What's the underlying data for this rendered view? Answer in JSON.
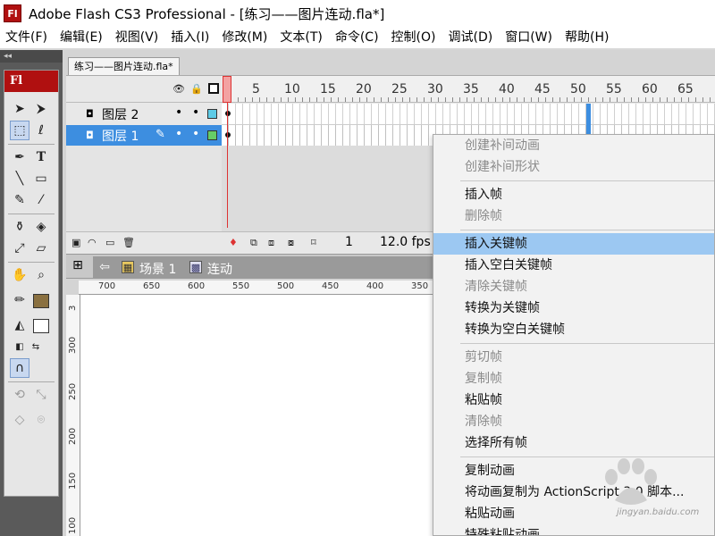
{
  "app": {
    "title": "Adobe Flash CS3 Professional - [练习——图片连动.fla*]",
    "logo_text": "Fl"
  },
  "menubar": {
    "items": [
      "文件(F)",
      "编辑(E)",
      "视图(V)",
      "插入(I)",
      "修改(M)",
      "文本(T)",
      "命令(C)",
      "控制(O)",
      "调试(D)",
      "窗口(W)",
      "帮助(H)"
    ]
  },
  "toolbar": {
    "logo": "Fl",
    "panel_collapse": "◂◂"
  },
  "document": {
    "tab_label": "练习——图片连动.fla*"
  },
  "timeline": {
    "ruler_numbers": [
      "5",
      "10",
      "15",
      "20",
      "25",
      "30",
      "35",
      "40",
      "45",
      "50",
      "55",
      "60",
      "65"
    ],
    "layers": [
      {
        "name": "图层 2",
        "color": "#5ecbe6",
        "selected": false
      },
      {
        "name": "图层 1",
        "color": "#66cc66",
        "selected": true
      }
    ],
    "current_frame": "1",
    "fps": "12.0 fps"
  },
  "scene_bar": {
    "scene_label": "场景 1",
    "symbol_label": "连动"
  },
  "stage": {
    "hruler_numbers": [
      "700",
      "650",
      "600",
      "550",
      "500",
      "450",
      "400",
      "350"
    ],
    "vruler_numbers": [
      "3",
      "300",
      "250",
      "200",
      "150",
      "100"
    ]
  },
  "context_menu": {
    "items": [
      {
        "label": "创建补间动画",
        "disabled": true
      },
      {
        "label": "创建补间形状",
        "disabled": true
      },
      {
        "sep": true
      },
      {
        "label": "插入帧",
        "disabled": false
      },
      {
        "label": "删除帧",
        "disabled": true
      },
      {
        "sep": true
      },
      {
        "label": "插入关键帧",
        "disabled": false,
        "highlighted": true
      },
      {
        "label": "插入空白关键帧",
        "disabled": false
      },
      {
        "label": "清除关键帧",
        "disabled": true
      },
      {
        "label": "转换为关键帧",
        "disabled": false
      },
      {
        "label": "转换为空白关键帧",
        "disabled": false
      },
      {
        "sep": true
      },
      {
        "label": "剪切帧",
        "disabled": true
      },
      {
        "label": "复制帧",
        "disabled": true
      },
      {
        "label": "粘贴帧",
        "disabled": false
      },
      {
        "label": "清除帧",
        "disabled": true
      },
      {
        "label": "选择所有帧",
        "disabled": false
      },
      {
        "sep": true
      },
      {
        "label": "复制动画",
        "disabled": false
      },
      {
        "label": "将动画复制为 ActionScript 3.0 脚本...",
        "disabled": false
      },
      {
        "label": "粘贴动画",
        "disabled": false
      },
      {
        "label": "特殊粘贴动画...",
        "disabled": false
      }
    ]
  },
  "watermark": {
    "text": "jingyan.baidu.com"
  },
  "colors": {
    "selection_blue": "#3d8ee0",
    "menu_highlight": "#9cc8f2",
    "playhead_red": "#dd3333",
    "brand_red": "#b01010"
  }
}
